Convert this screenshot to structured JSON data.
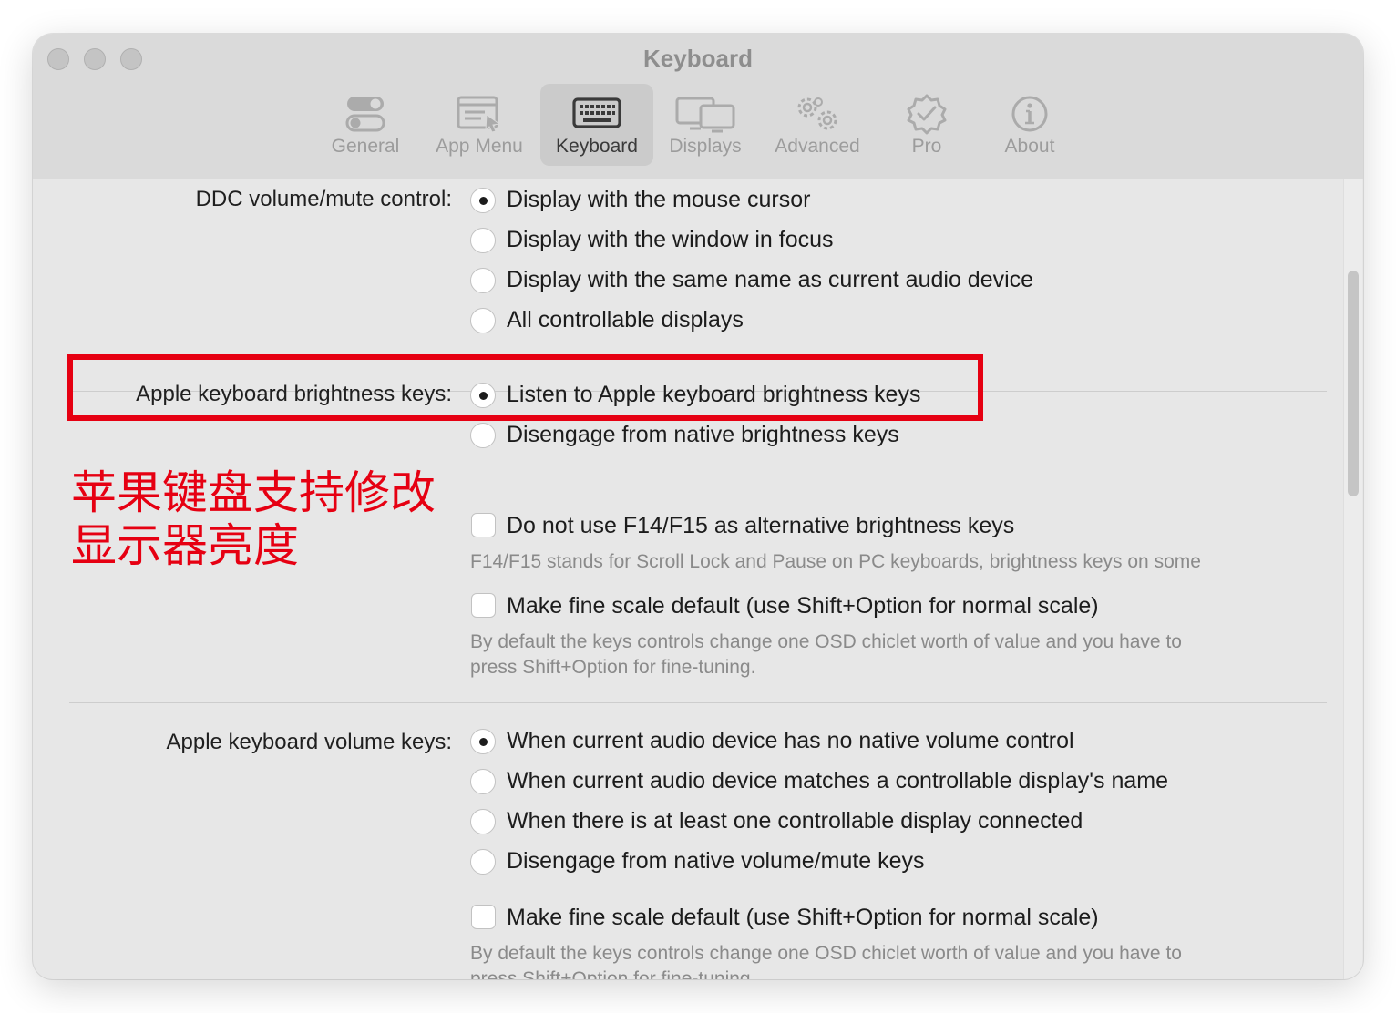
{
  "window": {
    "title": "Keyboard"
  },
  "tabs": [
    {
      "label": "General",
      "icon": "toggle-switches-icon",
      "selected": false
    },
    {
      "label": "App Menu",
      "icon": "app-menu-icon",
      "selected": false
    },
    {
      "label": "Keyboard",
      "icon": "keyboard-icon",
      "selected": true
    },
    {
      "label": "Displays",
      "icon": "displays-icon",
      "selected": false
    },
    {
      "label": "Advanced",
      "icon": "gears-icon",
      "selected": false
    },
    {
      "label": "Pro",
      "icon": "verified-badge-icon",
      "selected": false
    },
    {
      "label": "About",
      "icon": "info-icon",
      "selected": false
    }
  ],
  "ddc": {
    "label": "DDC volume/mute control:",
    "options": [
      {
        "text": "Display with the mouse cursor",
        "checked": true
      },
      {
        "text": "Display with the window in focus",
        "checked": false
      },
      {
        "text": "Display with the same name as current audio device",
        "checked": false
      },
      {
        "text": "All controllable displays",
        "checked": false
      }
    ]
  },
  "brightness": {
    "label": "Apple keyboard brightness keys:",
    "options": [
      {
        "text": "Listen to Apple keyboard brightness keys",
        "checked": true
      },
      {
        "text": "Disengage from native brightness keys",
        "checked": false
      }
    ],
    "checkbox_f14": {
      "text": "Do not use F14/F15 as alternative brightness keys",
      "checked": false,
      "help": "F14/F15 stands for Scroll Lock and Pause on PC keyboards, brightness keys on some"
    },
    "checkbox_fine": {
      "text": "Make fine scale default (use Shift+Option for normal scale)",
      "checked": false,
      "help_line1": "By default the keys controls change one OSD chiclet worth of value and you have to",
      "help_line2": "press Shift+Option for fine-tuning."
    }
  },
  "volume": {
    "label": "Apple keyboard volume keys:",
    "options": [
      {
        "text": "When current audio device has no native volume control",
        "checked": true
      },
      {
        "text": "When current audio device matches a controllable display's name",
        "checked": false
      },
      {
        "text": "When there is at least one controllable display connected",
        "checked": false
      },
      {
        "text": "Disengage from native volume/mute keys",
        "checked": false
      }
    ],
    "checkbox_fine": {
      "text": "Make fine scale default (use Shift+Option for normal scale)",
      "checked": false,
      "help_line1": "By default the keys controls change one OSD chiclet worth of value and you have to",
      "help_line2": "press Shift+Option for fine-tuning."
    }
  },
  "annotation": {
    "line1": "苹果键盘支持修改",
    "line2": "显示器亮度",
    "color": "#e60012"
  },
  "colors": {
    "highlight": "#e60012",
    "window_bg": "#e7e7e7",
    "toolbar_bg": "#dadada"
  }
}
